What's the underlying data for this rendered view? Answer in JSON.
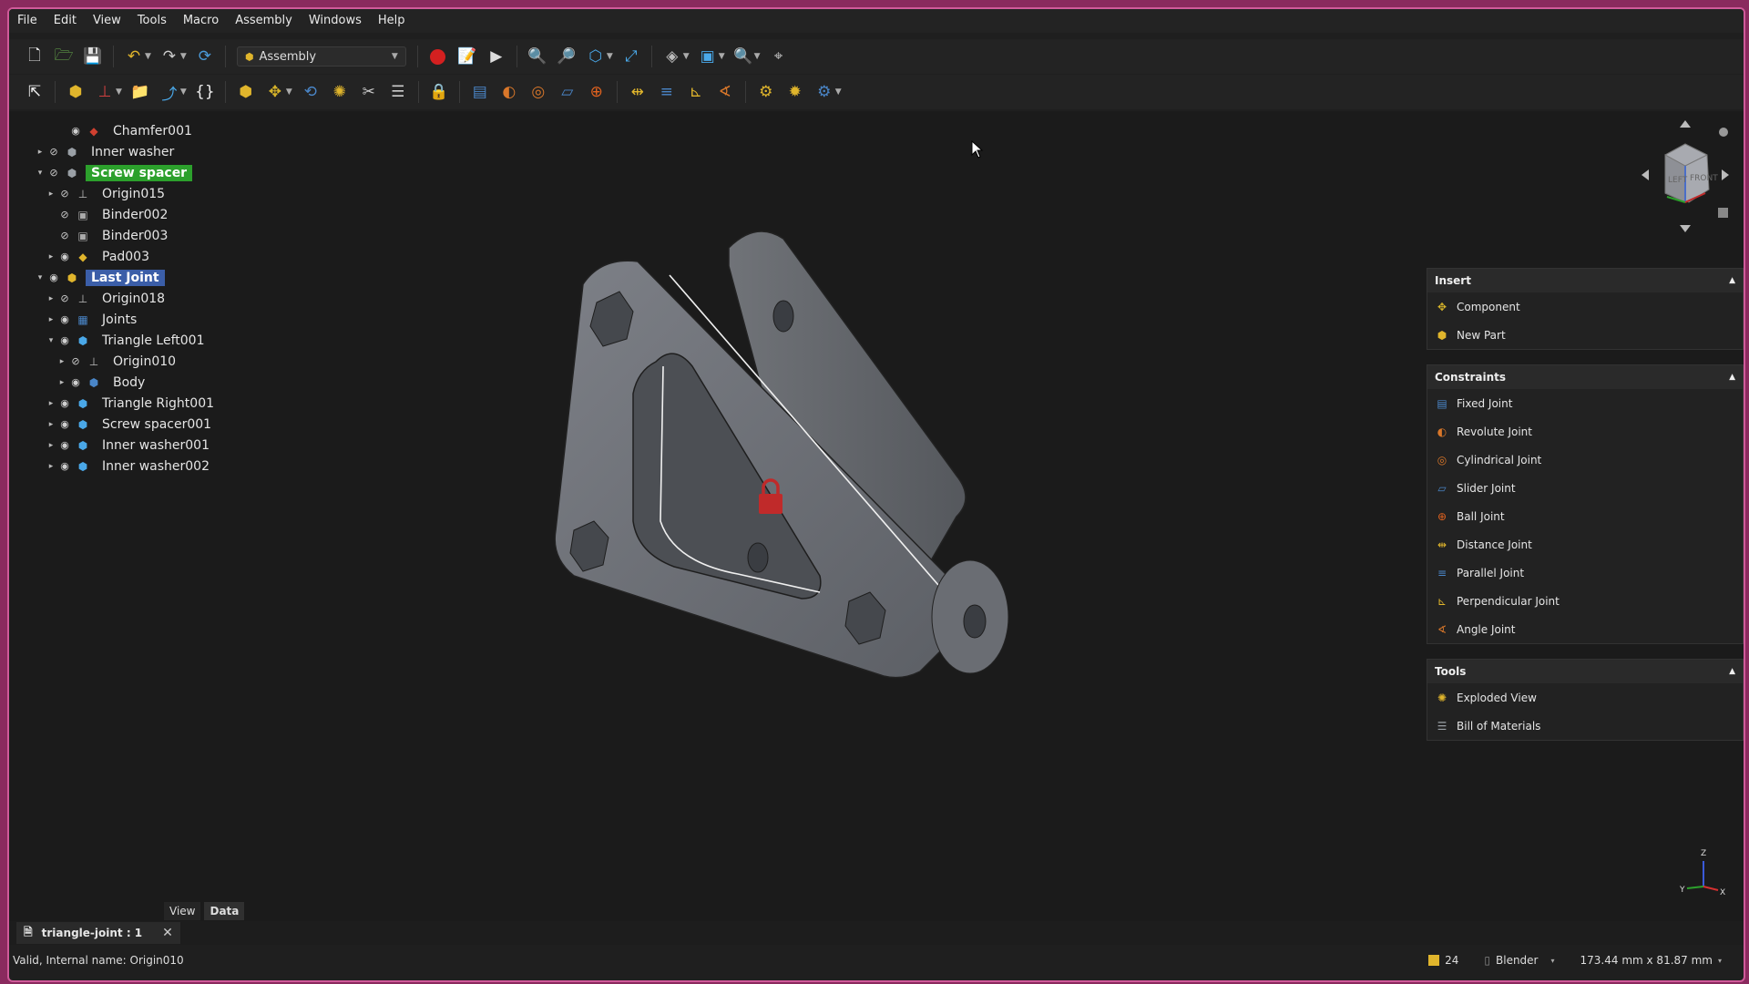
{
  "menu": [
    "File",
    "Edit",
    "View",
    "Tools",
    "Macro",
    "Assembly",
    "Windows",
    "Help"
  ],
  "workbench": "Assembly",
  "tree": [
    {
      "label": "Chamfer001",
      "indent": 3,
      "arrow": "",
      "eye": "◉",
      "icon": "chamfer-icon",
      "style": ""
    },
    {
      "label": "Inner washer",
      "indent": 1,
      "arrow": "▸",
      "eye": "⊘",
      "icon": "part-icon",
      "style": ""
    },
    {
      "label": "Screw spacer",
      "indent": 1,
      "arrow": "▾",
      "eye": "⊘",
      "icon": "part-icon",
      "style": "sel-green"
    },
    {
      "label": "Origin015",
      "indent": 2,
      "arrow": "▸",
      "eye": "⊘",
      "icon": "origin-icon",
      "style": ""
    },
    {
      "label": "Binder002",
      "indent": 2,
      "arrow": "",
      "eye": "⊘",
      "icon": "binder-icon",
      "style": ""
    },
    {
      "label": "Binder003",
      "indent": 2,
      "arrow": "",
      "eye": "⊘",
      "icon": "binder-icon",
      "style": ""
    },
    {
      "label": "Pad003",
      "indent": 2,
      "arrow": "▸",
      "eye": "◉",
      "icon": "pad-icon",
      "style": ""
    },
    {
      "label": "Last Joint",
      "indent": 1,
      "arrow": "▾",
      "eye": "◉",
      "icon": "assembly-icon",
      "style": "sel-blue"
    },
    {
      "label": "Origin018",
      "indent": 2,
      "arrow": "▸",
      "eye": "⊘",
      "icon": "origin-icon",
      "style": ""
    },
    {
      "label": "Joints",
      "indent": 2,
      "arrow": "▸",
      "eye": "◉",
      "icon": "joints-icon",
      "style": ""
    },
    {
      "label": "Triangle Left001",
      "indent": 2,
      "arrow": "▾",
      "eye": "◉",
      "icon": "link-icon",
      "style": ""
    },
    {
      "label": "Origin010",
      "indent": 3,
      "arrow": "▸",
      "eye": "⊘",
      "icon": "origin-icon",
      "style": ""
    },
    {
      "label": "Body",
      "indent": 3,
      "arrow": "▸",
      "eye": "◉",
      "icon": "body-icon",
      "style": ""
    },
    {
      "label": "Triangle Right001",
      "indent": 2,
      "arrow": "▸",
      "eye": "◉",
      "icon": "link-icon",
      "style": ""
    },
    {
      "label": "Screw spacer001",
      "indent": 2,
      "arrow": "▸",
      "eye": "◉",
      "icon": "link-icon",
      "style": ""
    },
    {
      "label": "Inner washer001",
      "indent": 2,
      "arrow": "▸",
      "eye": "◉",
      "icon": "link-icon",
      "style": ""
    },
    {
      "label": "Inner washer002",
      "indent": 2,
      "arrow": "▸",
      "eye": "◉",
      "icon": "link-icon",
      "style": ""
    }
  ],
  "property_tabs": {
    "view": "View",
    "data": "Data"
  },
  "panels": {
    "insert": {
      "title": "Insert",
      "items": [
        {
          "label": "Component",
          "icon": "component-icon",
          "color": "#d6b32a"
        },
        {
          "label": "New Part",
          "icon": "new-part-icon",
          "color": "#e0b52c"
        }
      ]
    },
    "constraints": {
      "title": "Constraints",
      "items": [
        {
          "label": "Fixed Joint",
          "icon": "fixed-joint-icon",
          "color": "#4a86c8"
        },
        {
          "label": "Revolute Joint",
          "icon": "revolute-joint-icon",
          "color": "#d9772a"
        },
        {
          "label": "Cylindrical Joint",
          "icon": "cylindrical-joint-icon",
          "color": "#d9772a"
        },
        {
          "label": "Slider Joint",
          "icon": "slider-joint-icon",
          "color": "#4a86c8"
        },
        {
          "label": "Ball Joint",
          "icon": "ball-joint-icon",
          "color": "#e0621f"
        },
        {
          "label": "Distance Joint",
          "icon": "distance-joint-icon",
          "color": "#e0b52c"
        },
        {
          "label": "Parallel Joint",
          "icon": "parallel-joint-icon",
          "color": "#4a86c8"
        },
        {
          "label": "Perpendicular Joint",
          "icon": "perpendicular-joint-icon",
          "color": "#e0b52c"
        },
        {
          "label": "Angle Joint",
          "icon": "angle-joint-icon",
          "color": "#d9772a"
        }
      ]
    },
    "tools": {
      "title": "Tools",
      "items": [
        {
          "label": "Exploded View",
          "icon": "exploded-view-icon",
          "color": "#e0b52c"
        },
        {
          "label": "Bill of Materials",
          "icon": "bill-of-materials-icon",
          "color": "#9aa0a6"
        }
      ]
    }
  },
  "navcube": {
    "left": "LEFT",
    "front": "FRONT"
  },
  "document_tab": "triangle-joint : 1",
  "status": {
    "message": "Valid, Internal name: Origin010",
    "zoom": "24",
    "nav_style": "Blender",
    "dimensions": "173.44 mm x 81.87 mm"
  },
  "axis_labels": {
    "x": "X",
    "y": "Y",
    "z": "Z"
  }
}
